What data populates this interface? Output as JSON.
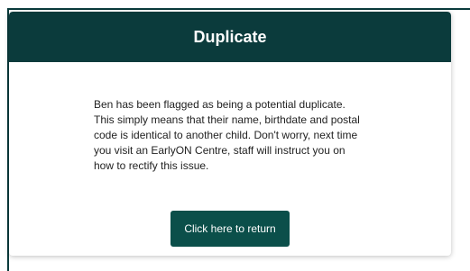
{
  "modal": {
    "title": "Duplicate",
    "message": "Ben has been flagged as being a potential duplicate. This simply means that their name, birthdate and postal code is identical to another child. Don't worry, next time you visit an EarlyON Centre, staff will instruct you on how to rectify this issue.",
    "button_label": "Click here to return"
  },
  "colors": {
    "header_bg": "#0b3b3c",
    "button_bg": "#0b4f4a",
    "text": "#222222"
  }
}
